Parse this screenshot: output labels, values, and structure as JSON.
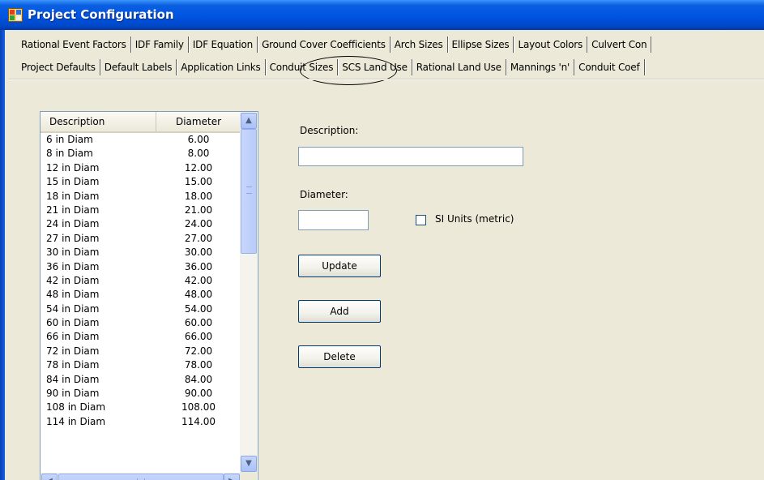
{
  "window": {
    "title": "Project Configuration"
  },
  "tabs": {
    "row1": [
      {
        "label": "Rational Event Factors"
      },
      {
        "label": "IDF Family"
      },
      {
        "label": "IDF Equation"
      },
      {
        "label": "Ground Cover Coefficients"
      },
      {
        "label": "Arch Sizes"
      },
      {
        "label": "Ellipse Sizes"
      },
      {
        "label": "Layout Colors"
      },
      {
        "label": "Culvert Con"
      }
    ],
    "row2": [
      {
        "label": "Project Defaults"
      },
      {
        "label": "Default Labels"
      },
      {
        "label": "Application Links"
      },
      {
        "label": "Conduit Sizes",
        "active": true
      },
      {
        "label": "SCS Land Use"
      },
      {
        "label": "Rational Land Use"
      },
      {
        "label": "Mannings 'n'"
      },
      {
        "label": "Conduit Coef"
      }
    ]
  },
  "list": {
    "columns": [
      "Description",
      "Diameter"
    ],
    "rows": [
      [
        "6 in Diam",
        "6.00"
      ],
      [
        "8 in Diam",
        "8.00"
      ],
      [
        "12 in Diam",
        "12.00"
      ],
      [
        "15 in Diam",
        "15.00"
      ],
      [
        "18 in Diam",
        "18.00"
      ],
      [
        "21 in Diam",
        "21.00"
      ],
      [
        "24 in Diam",
        "24.00"
      ],
      [
        "27 in Diam",
        "27.00"
      ],
      [
        "30 in Diam",
        "30.00"
      ],
      [
        "36 in Diam",
        "36.00"
      ],
      [
        "42 in Diam",
        "42.00"
      ],
      [
        "48 in Diam",
        "48.00"
      ],
      [
        "54 in Diam",
        "54.00"
      ],
      [
        "60 in Diam",
        "60.00"
      ],
      [
        "66 in Diam",
        "66.00"
      ],
      [
        "72 in Diam",
        "72.00"
      ],
      [
        "78 in Diam",
        "78.00"
      ],
      [
        "84 in Diam",
        "84.00"
      ],
      [
        "90 in Diam",
        "90.00"
      ],
      [
        "108 in Diam",
        "108.00"
      ],
      [
        "114 in Diam",
        "114.00"
      ]
    ]
  },
  "form": {
    "description_label": "Description:",
    "description_value": "",
    "diameter_label": "Diameter:",
    "diameter_value": "",
    "si_units_label": "SI Units (metric)",
    "si_units_checked": false,
    "update_label": "Update",
    "add_label": "Add",
    "delete_label": "Delete"
  },
  "icons": {
    "app": "app-window-icon",
    "scroll_up": "triangle-up-icon",
    "scroll_down": "triangle-down-icon",
    "scroll_left": "triangle-left-icon",
    "scroll_right": "triangle-right-icon"
  },
  "colors": {
    "titlebar": "#0054e3",
    "window_bg": "#ece9d8",
    "input_border": "#7f9db9",
    "button_border": "#003c74"
  }
}
